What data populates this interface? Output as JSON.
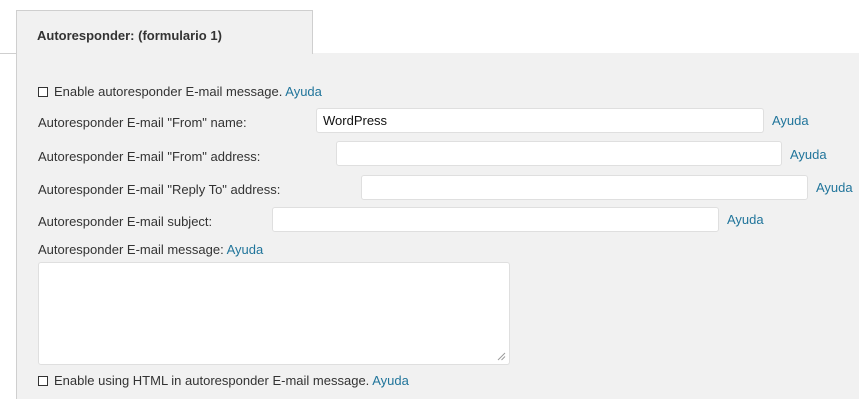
{
  "tab": {
    "label": "Autoresponder: (formulario 1)"
  },
  "enable_autoresponder": {
    "label": "Enable autoresponder E-mail message.",
    "help": "Ayuda",
    "checked": false
  },
  "from_name": {
    "label": "Autoresponder E-mail \"From\" name:",
    "value": "WordPress",
    "help": "Ayuda"
  },
  "from_address": {
    "label": "Autoresponder E-mail \"From\" address:",
    "value": "",
    "help": "Ayuda"
  },
  "reply_to": {
    "label": "Autoresponder E-mail \"Reply To\" address:",
    "value": "",
    "help": "Ayuda"
  },
  "subject": {
    "label": "Autoresponder E-mail subject:",
    "value": "",
    "help": "Ayuda"
  },
  "message": {
    "label": "Autoresponder E-mail message:",
    "help": "Ayuda",
    "value": ""
  },
  "enable_html": {
    "label": "Enable using HTML in autoresponder E-mail message.",
    "help": "Ayuda",
    "checked": false
  },
  "colors": {
    "link": "#21759b",
    "panel_background": "#f1f1f1",
    "text": "#333333"
  }
}
